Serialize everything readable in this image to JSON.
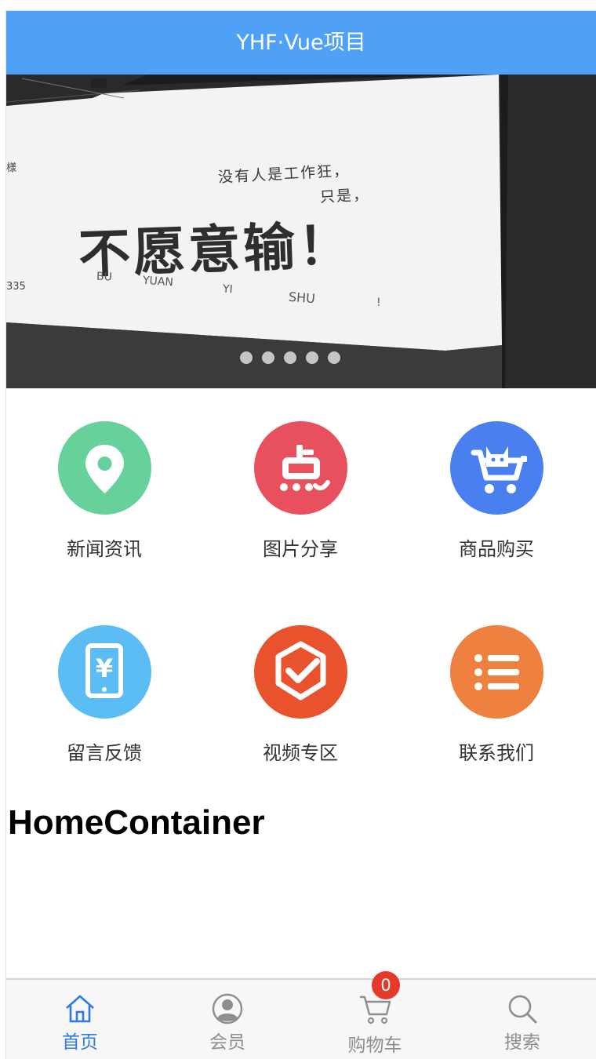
{
  "header": {
    "title": "YHF·Vue项目"
  },
  "banner": {
    "line1": "没有人是工作狂，",
    "line2": "只是，",
    "headline": "不愿意输！",
    "pinyin": [
      "BU",
      "YUAN",
      "YI",
      "SHU",
      "!"
    ],
    "side_left_top": "様",
    "side_left_bottom": "335",
    "slide_count": 5
  },
  "grid": {
    "items": [
      {
        "label": "新闻资讯",
        "icon": "location-pin-icon",
        "color": "#66d19a"
      },
      {
        "label": "图片分享",
        "icon": "dian-logo-icon",
        "color": "#e8505d"
      },
      {
        "label": "商品购买",
        "icon": "cat-cart-icon",
        "color": "#4a7ff0"
      },
      {
        "label": "留言反馈",
        "icon": "phone-yen-icon",
        "color": "#5bbdf3"
      },
      {
        "label": "视频专区",
        "icon": "hexagon-check-icon",
        "color": "#e8532e"
      },
      {
        "label": "联系我们",
        "icon": "list-icon",
        "color": "#ee8040"
      }
    ]
  },
  "main": {
    "heading": "HomeContainer"
  },
  "tabbar": {
    "tabs": [
      {
        "label": "首页",
        "icon": "home-icon",
        "active": true
      },
      {
        "label": "会员",
        "icon": "user-icon",
        "active": false
      },
      {
        "label": "购物车",
        "icon": "cart-icon",
        "active": false
      },
      {
        "label": "搜索",
        "icon": "search-icon",
        "active": false
      }
    ],
    "cart_badge": "0"
  },
  "colors": {
    "header_bg": "#4fa0f7",
    "active_tab": "#2e7be0",
    "badge": "#e5392a"
  }
}
